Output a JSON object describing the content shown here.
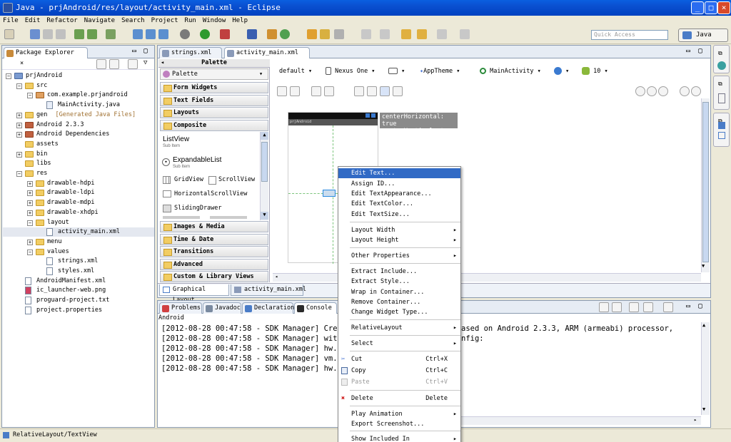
{
  "window": {
    "title": "Java - prjAndroid/res/layout/activity_main.xml - Eclipse"
  },
  "menu": [
    "File",
    "Edit",
    "Refactor",
    "Navigate",
    "Search",
    "Project",
    "Run",
    "Window",
    "Help"
  ],
  "toolbar": {
    "quick_access_placeholder": "Quick Access",
    "perspective": "Java"
  },
  "package_explorer": {
    "tab_label": "Package Explorer",
    "items": [
      {
        "label": "prjAndroid",
        "depth": 0,
        "icon": "project-icon"
      },
      {
        "label": "src",
        "depth": 1,
        "icon": "source-folder-icon"
      },
      {
        "label": "com.example.prjandroid",
        "depth": 2,
        "icon": "package-icon"
      },
      {
        "label": "MainActivity.java",
        "depth": 3,
        "icon": "java-file-icon"
      },
      {
        "label": "gen",
        "depth": 1,
        "icon": "source-folder-icon",
        "suffix": "[Generated Java Files]"
      },
      {
        "label": "Android 2.3.3",
        "depth": 1,
        "icon": "library-icon"
      },
      {
        "label": "Android Dependencies",
        "depth": 1,
        "icon": "library-icon"
      },
      {
        "label": "assets",
        "depth": 1,
        "icon": "folder-icon"
      },
      {
        "label": "bin",
        "depth": 1,
        "icon": "folder-icon"
      },
      {
        "label": "libs",
        "depth": 1,
        "icon": "folder-icon"
      },
      {
        "label": "res",
        "depth": 1,
        "icon": "folder-icon"
      },
      {
        "label": "drawable-hdpi",
        "depth": 2,
        "icon": "folder-icon"
      },
      {
        "label": "drawable-ldpi",
        "depth": 2,
        "icon": "folder-icon"
      },
      {
        "label": "drawable-mdpi",
        "depth": 2,
        "icon": "folder-icon"
      },
      {
        "label": "drawable-xhdpi",
        "depth": 2,
        "icon": "folder-icon"
      },
      {
        "label": "layout",
        "depth": 2,
        "icon": "folder-icon"
      },
      {
        "label": "activity_main.xml",
        "depth": 3,
        "icon": "xml-file-icon"
      },
      {
        "label": "menu",
        "depth": 2,
        "icon": "folder-icon"
      },
      {
        "label": "values",
        "depth": 2,
        "icon": "folder-icon"
      },
      {
        "label": "strings.xml",
        "depth": 3,
        "icon": "xml-file-icon"
      },
      {
        "label": "styles.xml",
        "depth": 3,
        "icon": "xml-file-icon"
      },
      {
        "label": "AndroidManifest.xml",
        "depth": 1,
        "icon": "xml-file-icon"
      },
      {
        "label": "ic_launcher-web.png",
        "depth": 1,
        "icon": "image-file-icon"
      },
      {
        "label": "proguard-project.txt",
        "depth": 1,
        "icon": "text-file-icon"
      },
      {
        "label": "project.properties",
        "depth": 1,
        "icon": "text-file-icon"
      }
    ]
  },
  "editor": {
    "tabs": [
      "strings.xml",
      "activity_main.xml"
    ],
    "bottom_tabs": [
      "Graphical Layout",
      "activity_main.xml"
    ]
  },
  "palette": {
    "header": "Palette",
    "dropdown": "Palette",
    "categories_top": [
      "Form Widgets",
      "Text Fields",
      "Layouts",
      "Composite"
    ],
    "composite_items": {
      "listview": "ListView",
      "listview_sub": "Sub Item",
      "expandable": "ExpandableList",
      "expandable_sub": "Sub Item",
      "gridview": "GridView",
      "scrollview": "ScrollView",
      "hscroll": "HorizontalScrollView",
      "sliding": "SlidingDrawer"
    },
    "categories_bottom": [
      "Images & Media",
      "Time & Date",
      "Transitions",
      "Advanced",
      "Custom & Library Views"
    ]
  },
  "config_bar": {
    "config": "default",
    "device": "Nexus One",
    "theme": "AppTheme",
    "activity": "MainActivity",
    "api": "10"
  },
  "canvas": {
    "tooltip_line1": "centerHorizontal: true",
    "tooltip_line2": "centerVertical: true",
    "app_title": "prjAndroid"
  },
  "context_menu": {
    "group1": [
      "Edit Text...",
      "Assign ID...",
      "Edit TextAppearance...",
      "Edit TextColor...",
      "Edit TextSize..."
    ],
    "group2": [
      "Layout Width",
      "Layout Height"
    ],
    "group3": [
      "Other Properties"
    ],
    "group4": [
      "Extract Include...",
      "Extract Style...",
      "Wrap in Container...",
      "Remove Container...",
      "Change Widget Type..."
    ],
    "group5": [
      "RelativeLayout"
    ],
    "group6": [
      "Select"
    ],
    "cut": "Cut",
    "cut_sc": "Ctrl+X",
    "copy": "Copy",
    "copy_sc": "Ctrl+C",
    "paste": "Paste",
    "paste_sc": "Ctrl+V",
    "delete": "Delete",
    "delete_sc": "Delete",
    "play": "Play Animation",
    "export": "Export Screenshot...",
    "show_included": "Show Included In"
  },
  "bottom_panel": {
    "tabs": [
      "Problems",
      "Javadoc",
      "Declaration",
      "Console"
    ],
    "console_name": "Android",
    "lines": [
      "[2012-08-28 00:47:58 - SDK Manager] Cre",
      "[2012-08-28 00:47:58 - SDK Manager] wit",
      "[2012-08-28 00:47:58 - SDK Manager] hw.",
      "[2012-08-28 00:47:58 - SDK Manager] vm.",
      "[2012-08-28 00:47:58 - SDK Manager] hw."
    ],
    "line_rest_1": "ased on Android 2.3.3, ARM (armeabi) processor,",
    "line_rest_2": "nfig:"
  },
  "status_bar": {
    "text": "RelativeLayout/TextView"
  }
}
